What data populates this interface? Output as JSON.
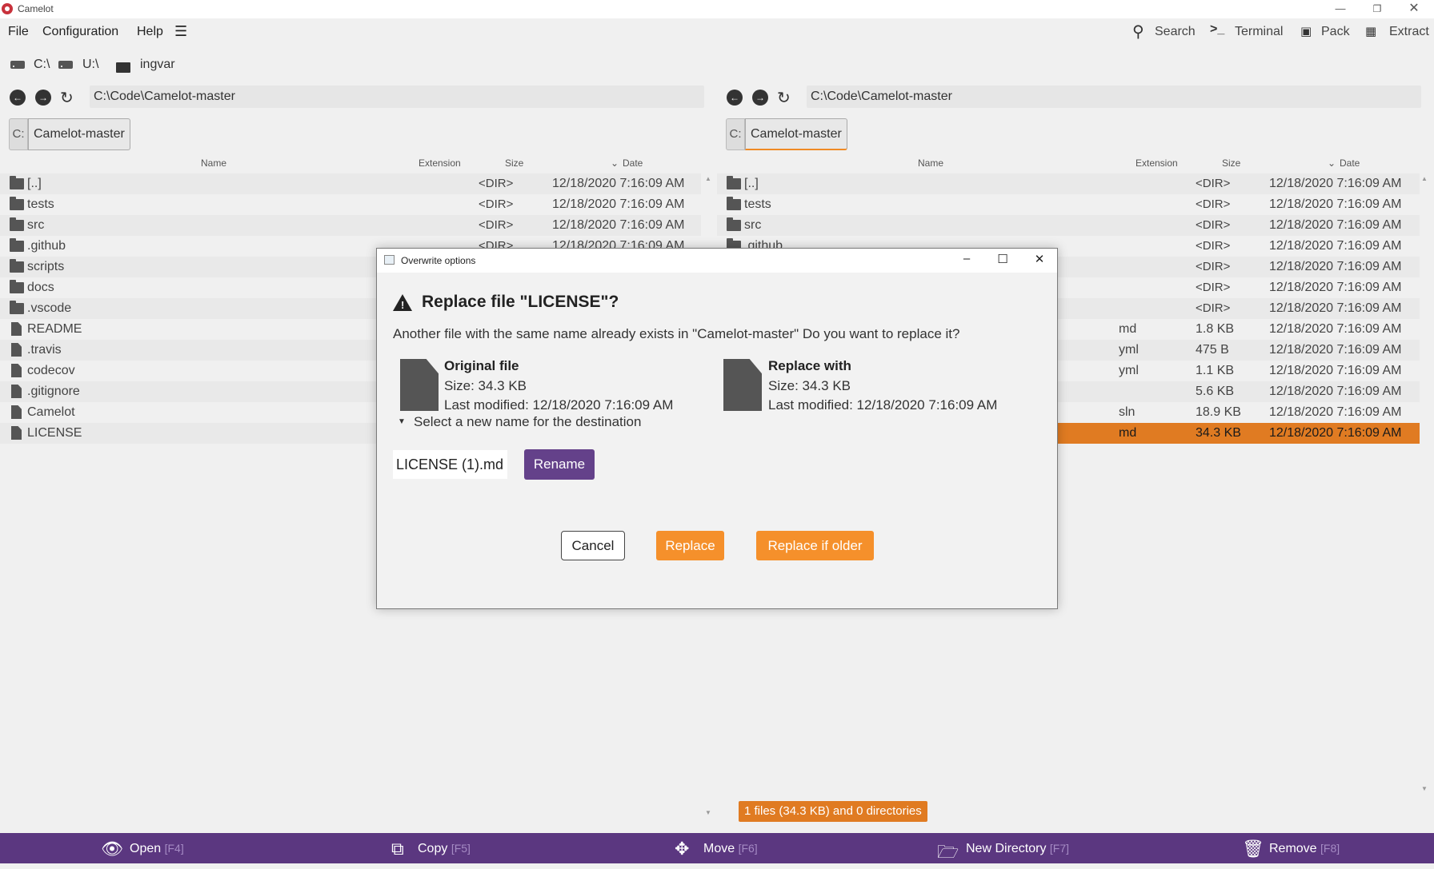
{
  "window": {
    "title": "Camelot"
  },
  "menu": {
    "file": "File",
    "configuration": "Configuration",
    "help": "Help"
  },
  "toolbar": {
    "search": "Search",
    "terminal": "Terminal",
    "pack": "Pack",
    "extract": "Extract"
  },
  "drives": [
    "C:\\",
    "U:\\",
    "ingvar"
  ],
  "columns": {
    "name": "Name",
    "extension": "Extension",
    "size": "Size",
    "date": "Date"
  },
  "left_panel": {
    "path": "C:\\Code\\Camelot-master",
    "tab_drive": "C:",
    "tab_label": "Camelot-master",
    "rows": [
      {
        "name": "[..]",
        "ext": "",
        "size": "<DIR>",
        "date": "12/18/2020 7:16:09 AM",
        "type": "folder"
      },
      {
        "name": "tests",
        "ext": "",
        "size": "<DIR>",
        "date": "12/18/2020 7:16:09 AM",
        "type": "folder"
      },
      {
        "name": "src",
        "ext": "",
        "size": "<DIR>",
        "date": "12/18/2020 7:16:09 AM",
        "type": "folder"
      },
      {
        "name": ".github",
        "ext": "",
        "size": "<DIR>",
        "date": "12/18/2020 7:16:09 AM",
        "type": "folder"
      },
      {
        "name": "scripts",
        "ext": "",
        "size": "",
        "date": "",
        "type": "folder"
      },
      {
        "name": "docs",
        "ext": "",
        "size": "",
        "date": "",
        "type": "folder"
      },
      {
        "name": ".vscode",
        "ext": "",
        "size": "",
        "date": "",
        "type": "folder"
      },
      {
        "name": "README",
        "ext": "",
        "size": "",
        "date": "",
        "type": "file"
      },
      {
        "name": ".travis",
        "ext": "",
        "size": "",
        "date": "",
        "type": "file"
      },
      {
        "name": "codecov",
        "ext": "",
        "size": "",
        "date": "",
        "type": "file"
      },
      {
        "name": ".gitignore",
        "ext": "",
        "size": "",
        "date": "",
        "type": "file"
      },
      {
        "name": "Camelot",
        "ext": "",
        "size": "",
        "date": "",
        "type": "file"
      },
      {
        "name": "LICENSE",
        "ext": "",
        "size": "",
        "date": "",
        "type": "file"
      }
    ]
  },
  "right_panel": {
    "path": "C:\\Code\\Camelot-master",
    "tab_drive": "C:",
    "tab_label": "Camelot-master",
    "rows": [
      {
        "name": "[..]",
        "ext": "",
        "size": "<DIR>",
        "date": "12/18/2020 7:16:09 AM",
        "type": "folder"
      },
      {
        "name": "tests",
        "ext": "",
        "size": "<DIR>",
        "date": "12/18/2020 7:16:09 AM",
        "type": "folder"
      },
      {
        "name": "src",
        "ext": "",
        "size": "<DIR>",
        "date": "12/18/2020 7:16:09 AM",
        "type": "folder"
      },
      {
        "name": ".github",
        "ext": "",
        "size": "<DIR>",
        "date": "12/18/2020 7:16:09 AM",
        "type": "folder"
      },
      {
        "name": "",
        "ext": "",
        "size": "<DIR>",
        "date": "12/18/2020 7:16:09 AM",
        "type": "none"
      },
      {
        "name": "",
        "ext": "",
        "size": "<DIR>",
        "date": "12/18/2020 7:16:09 AM",
        "type": "none"
      },
      {
        "name": "",
        "ext": "",
        "size": "<DIR>",
        "date": "12/18/2020 7:16:09 AM",
        "type": "none"
      },
      {
        "name": "",
        "ext": "md",
        "size": "1.8 KB",
        "date": "12/18/2020 7:16:09 AM",
        "type": "none"
      },
      {
        "name": "",
        "ext": "yml",
        "size": "475 B",
        "date": "12/18/2020 7:16:09 AM",
        "type": "none"
      },
      {
        "name": "",
        "ext": "yml",
        "size": "1.1 KB",
        "date": "12/18/2020 7:16:09 AM",
        "type": "none"
      },
      {
        "name": "",
        "ext": "",
        "size": "5.6 KB",
        "date": "12/18/2020 7:16:09 AM",
        "type": "none"
      },
      {
        "name": "",
        "ext": "sln",
        "size": "18.9 KB",
        "date": "12/18/2020 7:16:09 AM",
        "type": "none"
      },
      {
        "name": "",
        "ext": "md",
        "size": "34.3 KB",
        "date": "12/18/2020 7:16:09 AM",
        "type": "none",
        "selected": true
      }
    ]
  },
  "status": "1 files (34.3 KB) and 0 directories",
  "bottom": {
    "open": "Open",
    "open_key": "[F4]",
    "copy": "Copy",
    "copy_key": "[F5]",
    "move": "Move",
    "move_key": "[F6]",
    "newdir": "New Directory",
    "newdir_key": "[F7]",
    "remove": "Remove",
    "remove_key": "[F8]"
  },
  "dialog": {
    "title": "Overwrite options",
    "heading": "Replace file \"LICENSE\"?",
    "message": "Another file with the same name already exists in \"Camelot-master\" Do you want to replace it?",
    "original": {
      "title": "Original file",
      "size": "Size: 34.3 KB",
      "modified": "Last modified: 12/18/2020 7:16:09 AM"
    },
    "replace_with": {
      "title": "Replace with",
      "size": "Size: 34.3 KB",
      "modified": "Last modified: 12/18/2020 7:16:09 AM"
    },
    "expander": "Select a new name for the destination",
    "new_name": "LICENSE (1).md",
    "rename": "Rename",
    "cancel": "Cancel",
    "replace": "Replace",
    "replace_if_older": "Replace if older"
  },
  "colors": {
    "accent": "#f5902b",
    "selection": "#e07b22",
    "bottom_bar": "#5b3780",
    "rename": "#64418a"
  }
}
